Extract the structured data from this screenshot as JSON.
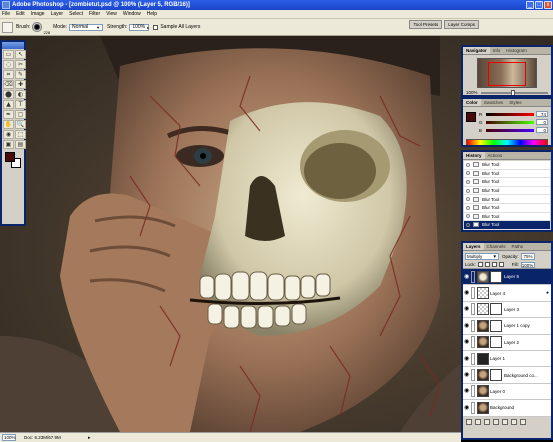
{
  "window": {
    "title": "Adobe Photoshop - [zombietut.psd @ 100% (Layer 5, RGB/16)]",
    "buttons": {
      "minimize": "_",
      "maximize": "□",
      "close": "x"
    }
  },
  "menu": [
    "File",
    "Edit",
    "Image",
    "Layer",
    "Select",
    "Filter",
    "View",
    "Window",
    "Help"
  ],
  "options": {
    "brush_label": "Brush:",
    "brush_size": "228",
    "mode_label": "Mode:",
    "mode_value": "Normal",
    "strength_label": "Strength:",
    "strength_value": "100%",
    "sample_all_label": "Sample All Layers",
    "well_tabs": [
      "Tool Presets",
      "Layer Comps"
    ]
  },
  "toolbox": {
    "tools": [
      "▭",
      "↖",
      "◌",
      "✂",
      "⌗",
      "✎",
      "⌫",
      "✚",
      "⬤",
      "◐",
      "▲",
      "T",
      "✒",
      "▢",
      "✋",
      "🔍",
      "◉",
      "⬚",
      "▣",
      "▤"
    ],
    "foreground_color": "#4a0a0a",
    "background_color": "#ffffff"
  },
  "navigator": {
    "tabs": [
      "Navigator",
      "Info",
      "Histogram"
    ],
    "zoom": "100%"
  },
  "color": {
    "tabs": [
      "Color",
      "Swatches",
      "Styles"
    ],
    "channels": [
      {
        "name": "R",
        "value": "74"
      },
      {
        "name": "G",
        "value": "0"
      },
      {
        "name": "B",
        "value": "0"
      }
    ]
  },
  "history": {
    "tabs": [
      "History",
      "Actions"
    ],
    "items": [
      "Blur Tool",
      "Blur Tool",
      "Blur Tool",
      "Blur Tool",
      "Blur Tool",
      "Blur Tool",
      "Blur Tool",
      "Blur Tool"
    ],
    "selected_index": 7
  },
  "layers": {
    "tabs": [
      "Layers",
      "Channels",
      "Paths"
    ],
    "blend_mode": "Multiply",
    "opacity_label": "Opacity:",
    "opacity": "75%",
    "lock_label": "Lock:",
    "fill_label": "Fill:",
    "fill": "100%",
    "items": [
      {
        "name": "Layer 5",
        "thumb": "thumb-skull",
        "mask": "mask-black",
        "fx": "",
        "selected": true
      },
      {
        "name": "Layer 4",
        "thumb": "thumb-check",
        "mask": "",
        "fx": "●",
        "selected": false
      },
      {
        "name": "Layer 3",
        "thumb": "thumb-check",
        "mask": "mask-black",
        "fx": "",
        "selected": false
      },
      {
        "name": "Layer 1 copy",
        "thumb": "thumb-face",
        "mask": "mask-white",
        "fx": "",
        "selected": false
      },
      {
        "name": "Layer 2",
        "thumb": "thumb-face",
        "mask": "mask-white",
        "fx": "",
        "selected": false
      },
      {
        "name": "Layer 1",
        "thumb": "thumb-dark",
        "mask": "",
        "fx": "",
        "selected": false
      },
      {
        "name": "Background co...",
        "thumb": "thumb-face",
        "mask": "mask-white",
        "fx": "",
        "selected": false
      },
      {
        "name": "Layer 0",
        "thumb": "thumb-face",
        "mask": "",
        "fx": "",
        "selected": false
      },
      {
        "name": "Background",
        "thumb": "thumb-face",
        "mask": "",
        "fx": "",
        "selected": false
      }
    ]
  },
  "status": {
    "zoom": "100%",
    "doc": "Doc: 6.23M/67.9M"
  }
}
